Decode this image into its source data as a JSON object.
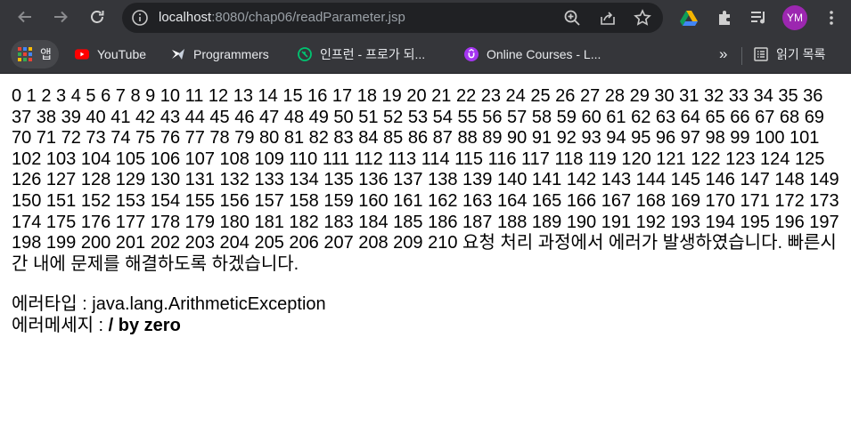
{
  "browser": {
    "url_host": "localhost",
    "url_path": ":8080/chap06/readParameter.jsp",
    "avatar_initials": "YM",
    "bookmarks": [
      {
        "label": "앱",
        "icon": "apps-grid-icon"
      },
      {
        "label": "YouTube",
        "icon": "youtube-icon"
      },
      {
        "label": "Programmers",
        "icon": "programmers-icon"
      },
      {
        "label": "인프런 - 프로가 되...",
        "icon": "inflearn-icon"
      },
      {
        "label": "Online Courses - L...",
        "icon": "udemy-icon"
      }
    ],
    "overflow_label": "»",
    "reading_list_label": "읽기 목록"
  },
  "page": {
    "numbers": "0 1 2 3 4 5 6 7 8 9 10 11 12 13 14 15 16 17 18 19 20 21 22 23 24 25 26 27 28 29 30 31 32 33 34 35 36 37 38 39 40 41 42 43 44 45 46 47 48 49 50 51 52 53 54 55 56 57 58 59 60 61 62 63 64 65 66 67 68 69 70 71 72 73 74 75 76 77 78 79 80 81 82 83 84 85 86 87 88 89 90 91 92 93 94 95 96 97 98 99 100 101 102 103 104 105 106 107 108 109 110 111 112 113 114 115 116 117 118 119 120 121 122 123 124 125 126 127 128 129 130 131 132 133 134 135 136 137 138 139 140 141 142 143 144 145 146 147 148 149 150 151 152 153 154 155 156 157 158 159 160 161 162 163 164 165 166 167 168 169 170 171 172 173 174 175 176 177 178 179 180 181 182 183 184 185 186 187 188 189 190 191 192 193 194 195 196 197 198 199 200 201 202 203 204 205 206 207 208 209 210",
    "error_message": "요청 처리 과정에서 에러가 발생하였습니다. 빠른시간 내에 문제를 해결하도록 하겠습니다.",
    "error_type_label": "에러타입 : ",
    "error_type_value": "java.lang.ArithmeticException",
    "error_message_label": "에러메세지 : ",
    "error_message_value": "/ by zero"
  },
  "colors": {
    "chrome_bg": "#35363a",
    "omnibox_bg": "#202124",
    "avatar_bg": "#9c27b0",
    "youtube_red": "#ff0000",
    "udemy_purple": "#a435f0",
    "inflearn_green": "#00c471"
  }
}
